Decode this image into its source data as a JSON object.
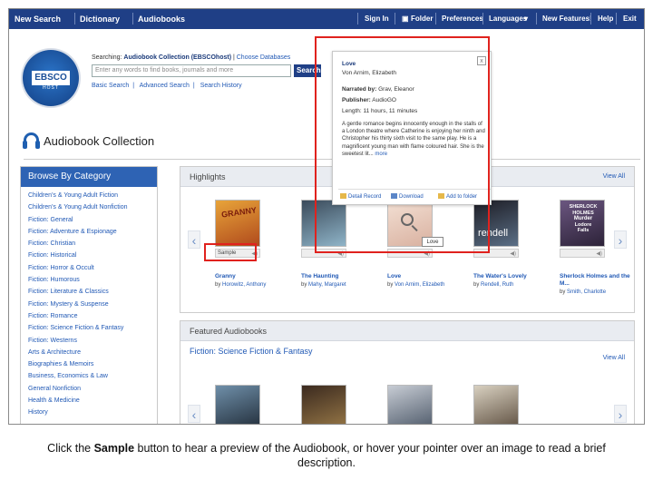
{
  "topnav": {
    "left": [
      "New Search",
      "Dictionary",
      "Audiobooks"
    ],
    "right": [
      "Sign In",
      "Folder",
      "Preferences",
      "Languages",
      "New Features!",
      "Help",
      "Exit"
    ],
    "languages_caret": "▾"
  },
  "logo": {
    "top": "EBSCO",
    "bottom": "HOST"
  },
  "search": {
    "searching_label": "Searching:",
    "collection": "Audiobook Collection (EBSCOhost)",
    "choose_db": "Choose Databases",
    "placeholder": "Enter any words to find books, journals and more",
    "button": "Search",
    "links": [
      "Basic Search",
      "Advanced Search",
      "Search History"
    ]
  },
  "page_title": "Audiobook Collection",
  "sidebar": {
    "title": "Browse By Category",
    "items": [
      "Children's & Young Adult Fiction",
      "Children's & Young Adult Nonfiction",
      "Fiction: General",
      "Fiction: Adventure & Espionage",
      "Fiction: Christian",
      "Fiction: Historical",
      "Fiction: Horror & Occult",
      "Fiction: Humorous",
      "Fiction: Literature & Classics",
      "Fiction: Mystery & Suspense",
      "Fiction: Romance",
      "Fiction: Science Fiction & Fantasy",
      "Fiction: Westerns",
      "Arts & Architecture",
      "Biographies & Memoirs",
      "Business, Economics & Law",
      "General Nonfiction",
      "Health & Medicine",
      "History"
    ]
  },
  "highlights": {
    "title": "Highlights",
    "view_all": "View All",
    "prev": "‹",
    "next": "›",
    "books": [
      {
        "title": "Granny",
        "by": "by",
        "author": "Horowitz, Anthony",
        "sample": "Sample",
        "color1": "#e8a43a",
        "color2": "#b04a1c"
      },
      {
        "title": "The Haunting",
        "by": "by",
        "author": "Mahy, Margaret",
        "sample": "",
        "color1": "#3a4a5a",
        "color2": "#8fb4c8"
      },
      {
        "title": "Love",
        "by": "by",
        "author": "Von Arnim, Elizabeth",
        "sample": "",
        "color1": "#f3e0d4",
        "color2": "#d9b1a0"
      },
      {
        "title": "The Water's Lovely",
        "by": "by",
        "author": "Rendell, Ruth",
        "sample": "",
        "color1": "#1c1c24",
        "color2": "#5b6f86"
      },
      {
        "title": "Sherlock Holmes and the M...",
        "by": "by",
        "author": "Smith, Charlotte",
        "sample": "",
        "color1": "#6b5680",
        "color2": "#2c2238"
      }
    ]
  },
  "cover_text": {
    "rendell": "rendell",
    "sherlock1": "SHERLOCK",
    "sherlock2": "HOLMES",
    "sherlock3": "Murder",
    "sherlock4": "Lodore",
    "sherlock5": "Falls",
    "granny": "GRANNY"
  },
  "featured": {
    "title": "Featured Audiobooks",
    "subtitle": "Fiction: Science Fiction & Fantasy",
    "view_all": "View All",
    "prev": "‹",
    "next": "›",
    "covers": [
      {
        "color1": "#6f8fa9",
        "color2": "#1f2a36"
      },
      {
        "color1": "#3b2a1f",
        "color2": "#9a7a48"
      },
      {
        "color1": "#c7ccd4",
        "color2": "#4a5666"
      },
      {
        "color1": "#d8d0c0",
        "color2": "#5a4b3c"
      }
    ]
  },
  "popup": {
    "close": "x",
    "title": "Love",
    "author": "Von Arnim, Elizabeth",
    "narrated_label": "Narrated by:",
    "narrator": "Grav, Eleanor",
    "publisher_label": "Publisher:",
    "publisher": "AudioGO",
    "length_label": "Length:",
    "length": "11 hours, 11 minutes",
    "description": "A gentle romance begins innocently enough in the stalls of a London theatre where Catherine is enjoying her ninth and Christopher his thirty sixth visit to the same play. He is a magnificent young man with flame coloured hair. She is the sweetest lit...",
    "more": "more",
    "actions": [
      "Detail Record",
      "Download",
      "Add to folder"
    ]
  },
  "tooltip": "Love",
  "caption": {
    "pre": "Click the ",
    "bold": "Sample",
    "post": " button to hear a preview of the Audiobook, or hover your pointer over an image to read a brief description."
  },
  "colors": {
    "nav": "#1f3f86",
    "link": "#2159b5",
    "highlight": "#e0221e"
  }
}
